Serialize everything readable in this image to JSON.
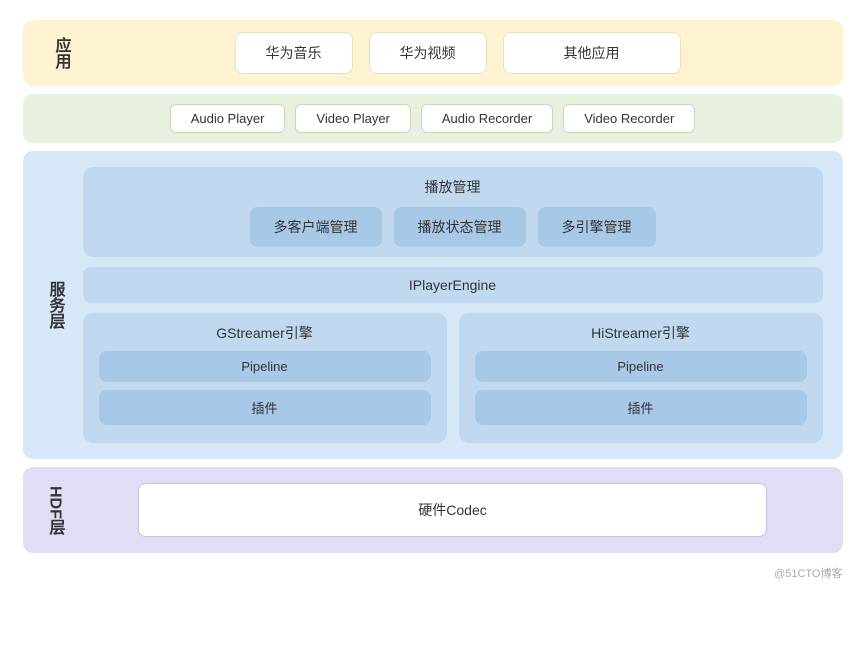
{
  "app_layer": {
    "label": "应用",
    "items": [
      {
        "text": "华为音乐"
      },
      {
        "text": "华为视频"
      },
      {
        "text": "其他应用",
        "wide": true
      }
    ]
  },
  "api_layer": {
    "items": [
      {
        "text": "Audio Player"
      },
      {
        "text": "Video Player"
      },
      {
        "text": "Audio Recorder"
      },
      {
        "text": "Video Recorder"
      }
    ]
  },
  "service_layer": {
    "label": "服务层",
    "play_management": {
      "title": "播放管理",
      "items": [
        {
          "text": "多客户端管理"
        },
        {
          "text": "播放状态管理"
        },
        {
          "text": "多引擎管理"
        }
      ]
    },
    "iplayerengine": "IPlayerEngine",
    "gstreamer": {
      "title": "GStreamer引擎",
      "pipeline": "Pipeline",
      "plugin": "插件"
    },
    "histreamer": {
      "title": "HiStreamer引擎",
      "pipeline": "Pipeline",
      "plugin": "插件"
    }
  },
  "hdf_layer": {
    "label": "HDF层",
    "box_text": "硬件Codec"
  },
  "watermark": "@51CTO博客"
}
